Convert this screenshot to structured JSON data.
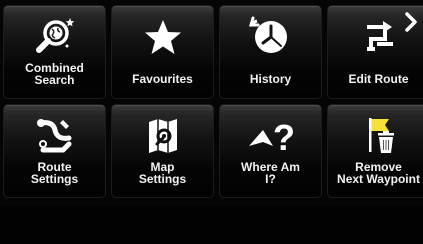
{
  "menu": {
    "rows": [
      [
        {
          "id": "combined-search",
          "label": "Combined\nSearch",
          "icon": "magnifier-globe-icon"
        },
        {
          "id": "favourites",
          "label": "Favourites",
          "icon": "star-icon"
        },
        {
          "id": "history",
          "label": "History",
          "icon": "clock-history-icon"
        },
        {
          "id": "edit-route",
          "label": "Edit Route",
          "icon": "route-edit-icon"
        }
      ],
      [
        {
          "id": "route-settings",
          "label": "Route\nSettings",
          "icon": "route-settings-icon"
        },
        {
          "id": "map-settings",
          "label": "Map\nSettings",
          "icon": "map-settings-icon"
        },
        {
          "id": "where-am-i",
          "label": "Where Am\nI?",
          "icon": "where-am-i-icon"
        },
        {
          "id": "remove-next-waypoint",
          "label": "Remove\nNext Waypoint",
          "icon": "remove-waypoint-icon"
        }
      ]
    ]
  },
  "navigation": {
    "next_page_icon": "chevron-right-icon"
  },
  "colors": {
    "background": "#050505",
    "text": "#f2f2f2",
    "icon": "#ffffff",
    "flag": "#f4e23a"
  }
}
